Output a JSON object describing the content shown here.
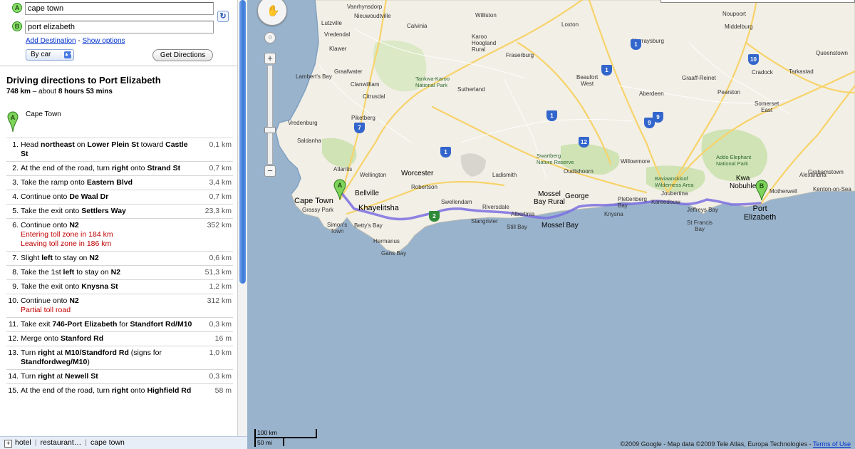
{
  "form": {
    "origin_value": "cape town",
    "origin_marker": "A",
    "destination_value": "port elizabeth",
    "destination_marker": "B",
    "add_destination": "Add Destination",
    "separator": "-",
    "show_options": "Show options",
    "travel_mode": "By car",
    "get_directions": "Get Directions"
  },
  "directions": {
    "title": "Driving directions to Port Elizabeth",
    "distance": "748 km",
    "summary_mid": " – about ",
    "duration": "8 hours 53 mins",
    "start_marker": "A",
    "start_label": "Cape Town",
    "steps": [
      {
        "num": "1.",
        "html": "Head <b>northeast</b> on <b>Lower Plein St</b> toward <b>Castle St</b>",
        "dist": "0,1 km"
      },
      {
        "num": "2.",
        "html": "At the end of the road, turn <b>right</b> onto <b>Strand St</b>",
        "dist": "0,7 km"
      },
      {
        "num": "3.",
        "html": "Take the ramp onto <b>Eastern Blvd</b>",
        "dist": "3,4 km"
      },
      {
        "num": "4.",
        "html": "Continue onto <b>De Waal Dr</b>",
        "dist": "0,7 km"
      },
      {
        "num": "5.",
        "html": "Take the exit onto <b>Settlers Way</b>",
        "dist": "23,3 km"
      },
      {
        "num": "6.",
        "html": "Continue onto <b>N2</b><br><span class=\"note\">Entering toll zone in 184 km</span><br><span class=\"note\">Leaving toll zone in 186 km</span>",
        "dist": "352 km"
      },
      {
        "num": "7.",
        "html": "Slight <b>left</b> to stay on <b>N2</b>",
        "dist": "0,6 km"
      },
      {
        "num": "8.",
        "html": "Take the 1st <b>left</b> to stay on <b>N2</b>",
        "dist": "51,3 km"
      },
      {
        "num": "9.",
        "html": "Take the exit onto <b>Knysna St</b>",
        "dist": "1,2 km"
      },
      {
        "num": "10.",
        "html": "Continue onto <b>N2</b><br><span class=\"note\">Partial toll road</span>",
        "dist": "312 km"
      },
      {
        "num": "11.",
        "html": "Take exit <b>746-Port Elizabeth</b> for <b>Standfort Rd/M10</b>",
        "dist": "0,3 km"
      },
      {
        "num": "12.",
        "html": "Merge onto <b>Stanford Rd</b>",
        "dist": "16 m"
      },
      {
        "num": "13.",
        "html": "Turn <b>right</b> at <b>M10/Standford Rd</b> (signs for <b>Standfordweg/M10</b>)",
        "dist": "1,0 km"
      },
      {
        "num": "14.",
        "html": "Turn <b>right</b> at <b>Newell St</b>",
        "dist": "0,3 km"
      },
      {
        "num": "15.",
        "html": "At the end of the road, turn <b>right</b> onto <b>Highfield Rd</b>",
        "dist": "58 m"
      }
    ]
  },
  "bottom_bar": {
    "item1": "hotel",
    "item2": "restaurant…",
    "item3": "cape town"
  },
  "map": {
    "scale_km": "100 km",
    "scale_mi": "50 mi",
    "copyright": "©2009 Google - Map data ©2009 Tele Atlas, Europa Technologies - ",
    "terms": "Terms of Use",
    "marker_a": "A",
    "marker_b": "B",
    "labels": {
      "vredendal": "Vredendal",
      "klawer": "Klawer",
      "lutzville": "Lutzville",
      "van_rhynsdorp": "Vanrhynsdorp",
      "nieuwoudtville": "Nieuwoudtville",
      "calvinia": "Calvinia",
      "williston": "Williston",
      "loxton": "Loxton",
      "noupoort": "Noupoort",
      "middelburg": "Middelburg",
      "sutherland": "Sutherland",
      "fraserburg": "Fraserburg",
      "karoo_hoogland": "Karoo\nHoogland\nRural",
      "graafwater": "Graafwater",
      "clanwilliam": "Clanwilliam",
      "lamberts_bay": "Lambert's Bay",
      "tankwa": "Tankwa-Karoo\nNational Park",
      "beaufort_west": "Beaufort\nWest",
      "murraysburg": "Murraysburg",
      "graaff_reinet": "Graaff-Reinet",
      "queenstown": "Queenstown",
      "tarkastad": "Tarkastad",
      "cradock": "Cradock",
      "aberdeen": "Aberdeen",
      "somerset_east": "Somerset\nEast",
      "pearston": "Pearston",
      "vredenburg": "Vredenburg",
      "saldanha": "Saldanha",
      "piketberg": "Piketberg",
      "citrusdal": "Citrusdal",
      "atlantis": "Atlantis",
      "wellington": "Wellington",
      "worcester": "Worcester",
      "ladismith": "Ladismith",
      "willowmore": "Willowmore",
      "swartberg": "Swartberg\nNature Reserve",
      "oudtshoorn": "Oudtshoorn",
      "grahamstown": "Grahamstown",
      "addo": "Addo Elephant\nNational Park",
      "alexandria": "Alexandria",
      "kenton": "Kenton-on-Sea",
      "kwanobuhle": "Kwa\nNobuhle",
      "motherwell": "Motherwell",
      "bellville": "Bellville",
      "cape_town": "Cape Town",
      "grassy_park": "Grassy Park",
      "khayelitsha": "Khayelitsha",
      "simons_town": "Simon's\nTown",
      "bettys_bay": "Betty's Bay",
      "hermanus": "Hermanus",
      "gans_bay": "Gans Bay",
      "robertson": "Robertson",
      "swellendam": "Swellendam",
      "riversdale": "Riversdale",
      "albertinia": "Albertinia",
      "slangrivier": "Slangrivier",
      "still_bay": "Still Bay",
      "mossel_bay_rural": "Mossel\nBay Rural",
      "george": "George",
      "mossel_bay": "Mossel Bay",
      "knysna": "Knysna",
      "plettenberg": "Plettenberg\nBay",
      "baviaans": "Baviaanskloof\nWilderness Area",
      "joubertina": "Joubertina",
      "kareedouw": "Kareedouw",
      "jeffreys_bay": "Jeffreys Bay",
      "st_francis": "St Francis\nBay",
      "port_elizabeth": "Port\nElizabeth",
      "nieuwoudtville2": "Nieuwoudtville",
      "bredasdorp": "Bredasdorp"
    },
    "shields": {
      "n7a": "7",
      "n1a": "1",
      "n1b": "1",
      "n1c": "1",
      "n1d": "1",
      "n9a": "9",
      "n9b": "9",
      "n12": "12",
      "n10": "10",
      "n2": "2"
    }
  },
  "colors": {
    "land": "#f2efe6",
    "water": "#99b3cc",
    "park": "#cfe3b4",
    "route": "#7b6ee0",
    "road_yellow": "#f7d36a",
    "toll_note": "#c00000",
    "link": "#0033cc"
  },
  "icons": {
    "reverse": "reverse-arrows-icon",
    "pan": "hand-icon",
    "zoom_in": "plus-icon",
    "zoom_out": "minus-icon",
    "zoom_reset": "circle-icon",
    "expand": "plus-box-icon"
  }
}
